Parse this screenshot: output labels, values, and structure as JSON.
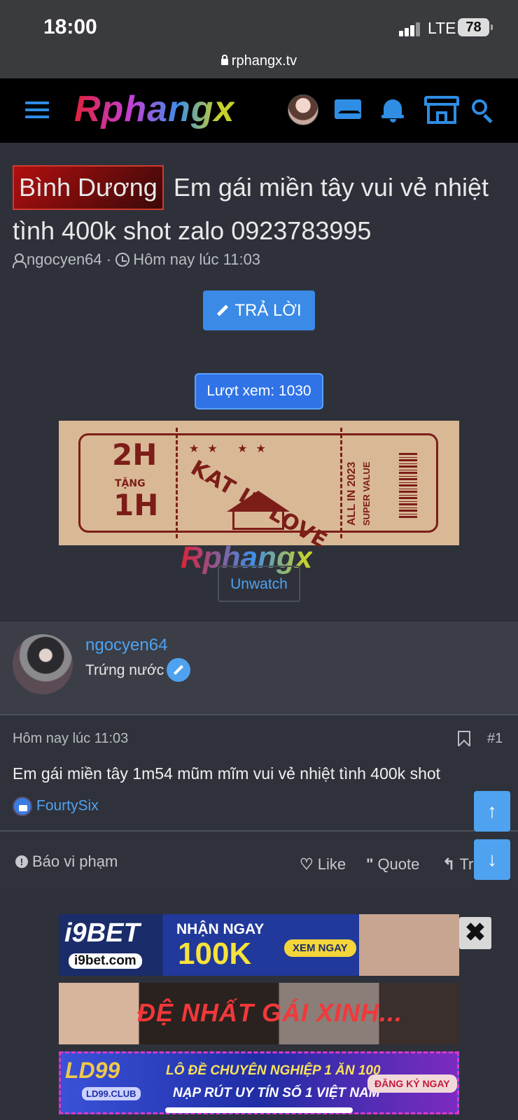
{
  "status_bar": {
    "time": "18:00",
    "network": "LTE",
    "battery": "78"
  },
  "browser": {
    "url": "rphangx.tv"
  },
  "site": {
    "logo": "Rphangx",
    "header_icons": [
      "menu-icon",
      "user-avatar",
      "mail-icon",
      "bell-icon",
      "store-icon",
      "search-icon"
    ],
    "accent_color": "#2f8de4"
  },
  "thread": {
    "prefix": "Bình Dương",
    "title": "Em gái miền tây vui vẻ nhiệt tình 400k shot zalo 0923783995",
    "author": "ngocyen64",
    "separator": "·",
    "time": "Hôm nay lúc 11:03",
    "reply_label": "TRẢ LỜI",
    "views_label": "Lượt xem: 1030",
    "unwatch_label": "Unwatch",
    "watermark": "Rphangx"
  },
  "banner": {
    "left_top": "2H",
    "left_mid": "TẶNG",
    "left_bottom": "1H",
    "center": "KAT IN LOVE",
    "right_1": "ALL IN 2023",
    "right_2": "SUPER VALUE"
  },
  "post": {
    "username": "ngocyen64",
    "user_title": "Trứng nước",
    "date": "Hôm nay lúc 11:03",
    "number": "#1",
    "text": "Em gái miền tây 1m54 mũm mĩm vui vẻ nhiệt tình 400k shot",
    "reaction_user": "FourtySix",
    "report_label": "Báo vi phạm",
    "like_label": "Like",
    "quote_label": "Quote",
    "reply_partial": "Tr"
  },
  "ads": {
    "ad1": {
      "brand": "i9BET",
      "domain": "i9bet.com",
      "line1": "NHẬN NGAY",
      "line2": "100K",
      "cta": "XEM NGAY"
    },
    "ad2": {
      "text": "ĐỆ NHẤT GÁI XINH..."
    },
    "ad3": {
      "brand": "LD99",
      "club": "LD99.CLUB",
      "line1": "LÔ ĐỀ CHUYÊN NGHIỆP 1 ĂN 100",
      "line2": "NẠP RÚT UY TÍN SỐ 1 VIỆT NAM",
      "cta": "ĐĂNG KÝ NGAY"
    },
    "close": "✖"
  }
}
